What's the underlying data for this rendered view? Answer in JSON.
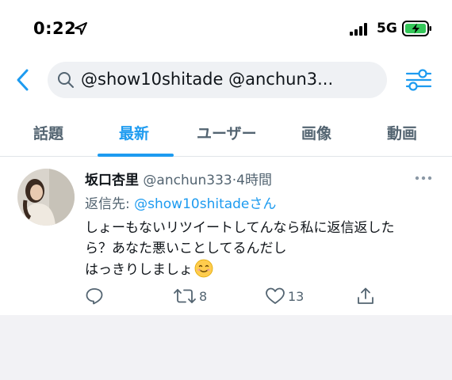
{
  "status_bar": {
    "time": "0:22",
    "network": "5G"
  },
  "search": {
    "query": "@show10shitade @anchun3..."
  },
  "tabs": [
    {
      "label": "話題",
      "active": false
    },
    {
      "label": "最新",
      "active": true
    },
    {
      "label": "ユーザー",
      "active": false
    },
    {
      "label": "画像",
      "active": false
    },
    {
      "label": "動画",
      "active": false
    }
  ],
  "tweet": {
    "name": "坂口杏里",
    "handle": "@anchun333",
    "separator": "·",
    "time": "4時間",
    "reply_prefix": "返信先: ",
    "reply_user": "@show10shitadeさん",
    "lines": [
      "しょーもないリツイートしてんなら私に返信返した",
      "ら？あなた悪いことしてるんだし",
      "はっきりしましょ"
    ],
    "emoji": "smiling-face",
    "retweet_count": "8",
    "like_count": "13"
  },
  "colors": {
    "accent": "#1d9bf0",
    "muted": "#536471",
    "text": "#0f1419"
  }
}
